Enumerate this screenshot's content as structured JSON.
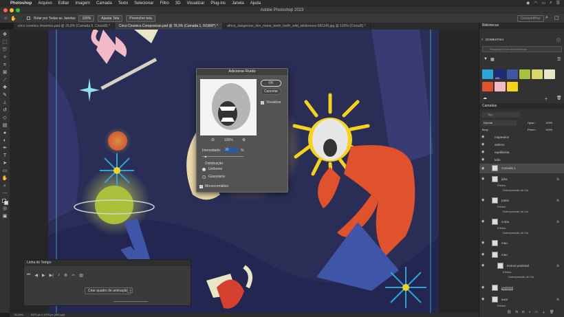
{
  "menubar": {
    "app": "Photoshop",
    "items": [
      "Arquivo",
      "Editar",
      "Imagem",
      "Camada",
      "Texto",
      "Selecionar",
      "Filtro",
      "3D",
      "Visualizar",
      "Plug-ins",
      "Janela",
      "Ajuda"
    ]
  },
  "title": "Adobe Photoshop 2023",
  "options": {
    "scroll_all": "Rolar por Todas as Janelas",
    "zoom": "100%",
    "fit_screen": "Ajustar Tela",
    "fill_screen": "Preencher tela",
    "share": "Compartilhar"
  },
  "tabs": [
    {
      "label": "circo cosmico imsomos.psd @ 25,8% (Camada 5, Cinza/8) *"
    },
    {
      "label": "Circo Cosmico Composicao.psd @ 78,3% (Camada 1, RGB/8*) *"
    },
    {
      "label": "africa_dangerous_lion_mane_teeth_tooth_wild_wilderness-981145.jpg @ 100% (Cinza/8) *"
    }
  ],
  "dialog": {
    "title": "Adicionar Ruído",
    "ok": "OK",
    "cancel": "Cancelar",
    "preview": "Visualizar",
    "zoom": "100%",
    "amount_label": "Intensidade:",
    "amount_value": "30",
    "amount_unit": "%",
    "amount_fraction": 0.075,
    "distribution": "Distribuição",
    "uniform": "Uniforme",
    "gaussian": "Gaussiana",
    "mono": "Monocromático"
  },
  "timeline": {
    "title": "Linha do Tempo",
    "create_frame": "Criar quadro de animação"
  },
  "status": {
    "zoom": "78,34%",
    "doc": "2479 px x 1379 px (300 ppi)"
  },
  "libraries": {
    "title": "Bibliotecas",
    "library": "DOMESTIKA",
    "search_placeholder": "Pesquisar todas as bibliotecas",
    "swatches": [
      "#2ba6d9",
      "#1e2a78",
      "#3f56a8",
      "#a9c13a",
      "#d8d76a",
      "#e9e6c5",
      "#e0522b",
      "#f2b9c6",
      "#f6d21a"
    ],
    "swatch_label": "#29..."
  },
  "layers_panel": {
    "title": "Camadas",
    "search": "Tipo",
    "blend": "Normal",
    "opacity": "Opac.:",
    "opacity_value": "100%",
    "lock": "Bloq.:",
    "fill": "Preen.:",
    "fill_value": "100%",
    "layers": [
      {
        "name": "mapeados",
        "type": "group"
      },
      {
        "name": "ateliers",
        "type": "group"
      },
      {
        "name": "equilibrista",
        "type": "group"
      },
      {
        "name": "leão",
        "type": "group"
      },
      {
        "name": "Camada 1",
        "type": "layer",
        "selected": true
      },
      {
        "name": "juba",
        "type": "layer",
        "fx": "fx",
        "effects": "Efeitos",
        "effect": "Sobreposição de Cor"
      },
      {
        "name": "patas",
        "type": "layer",
        "fx": "fx",
        "effects": "Efeitos",
        "effect": "Sobreposição de Cor"
      },
      {
        "name": "corpo",
        "type": "layer",
        "fx": "fx",
        "effects": "Efeitos",
        "effect": "Sobreposição de Cor"
      },
      {
        "name": "mao",
        "type": "layer"
      },
      {
        "name": "mao",
        "type": "layer"
      },
      {
        "name": "textura pedestal",
        "type": "layer",
        "fx": "fx",
        "effects": "Efeitos",
        "effect": "Sobreposição de Cor"
      },
      {
        "name": "pedestal",
        "type": "layer"
      },
      {
        "name": "aura",
        "type": "layer",
        "fx": "fx",
        "effects": "Efeitos"
      }
    ]
  }
}
